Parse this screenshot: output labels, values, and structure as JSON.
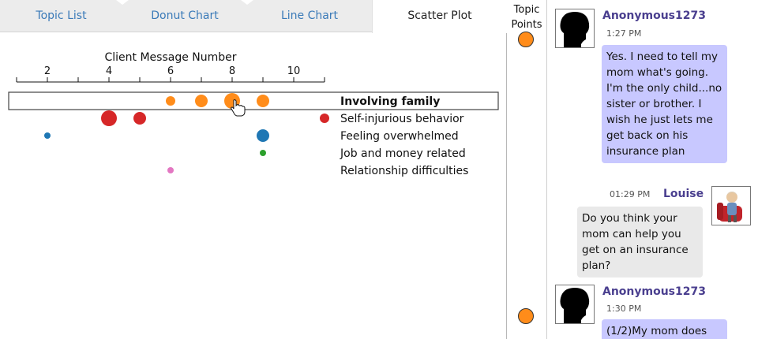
{
  "tabs": [
    {
      "label": "Topic List",
      "active": false
    },
    {
      "label": "Donut Chart",
      "active": false
    },
    {
      "label": "Line Chart",
      "active": false
    },
    {
      "label": "Scatter Plot",
      "active": true
    }
  ],
  "chart_data": {
    "type": "scatter",
    "xlabel": "Client Message Number",
    "x_ticks": [
      2,
      4,
      6,
      8,
      10
    ],
    "xlim": [
      1,
      11
    ],
    "grid": false,
    "highlighted_category": "Involving family",
    "series": [
      {
        "name": "Involving family",
        "color": "#ff8c1a",
        "points": [
          {
            "x": 6,
            "size": "small"
          },
          {
            "x": 7,
            "size": "medium"
          },
          {
            "x": 8,
            "size": "large"
          },
          {
            "x": 9,
            "size": "medium"
          }
        ]
      },
      {
        "name": "Self-injurious behavior",
        "color": "#d62728",
        "points": [
          {
            "x": 4,
            "size": "large"
          },
          {
            "x": 5,
            "size": "medium"
          },
          {
            "x": 11,
            "size": "small"
          }
        ]
      },
      {
        "name": "Feeling overwhelmed",
        "color": "#1f77b4",
        "points": [
          {
            "x": 2,
            "size": "tiny"
          },
          {
            "x": 9,
            "size": "medium"
          }
        ]
      },
      {
        "name": "Job and money related",
        "color": "#2ca02c",
        "points": [
          {
            "x": 9,
            "size": "tiny"
          }
        ]
      },
      {
        "name": "Relationship difficulties",
        "color": "#e377c2",
        "points": [
          {
            "x": 6,
            "size": "tiny"
          }
        ]
      }
    ]
  },
  "topic_points": {
    "title_line1": "Topic",
    "title_line2": "Points",
    "color": "#ff8c1a"
  },
  "chat": {
    "messages": [
      {
        "role": "client",
        "author": "Anonymous1273",
        "time": "1:27 PM",
        "text": "Yes. I need to tell my mom what's going. I'm the only child...no sister or brother. I wish he just lets me get back on his insurance plan"
      },
      {
        "role": "counselor",
        "author": "Louise",
        "time": "01:29 PM",
        "text": "Do you think your mom can help you get on an insurance plan?"
      },
      {
        "role": "client",
        "author": "Anonymous1273",
        "time": "1:30 PM",
        "text": "(1/2)My mom does"
      }
    ]
  }
}
